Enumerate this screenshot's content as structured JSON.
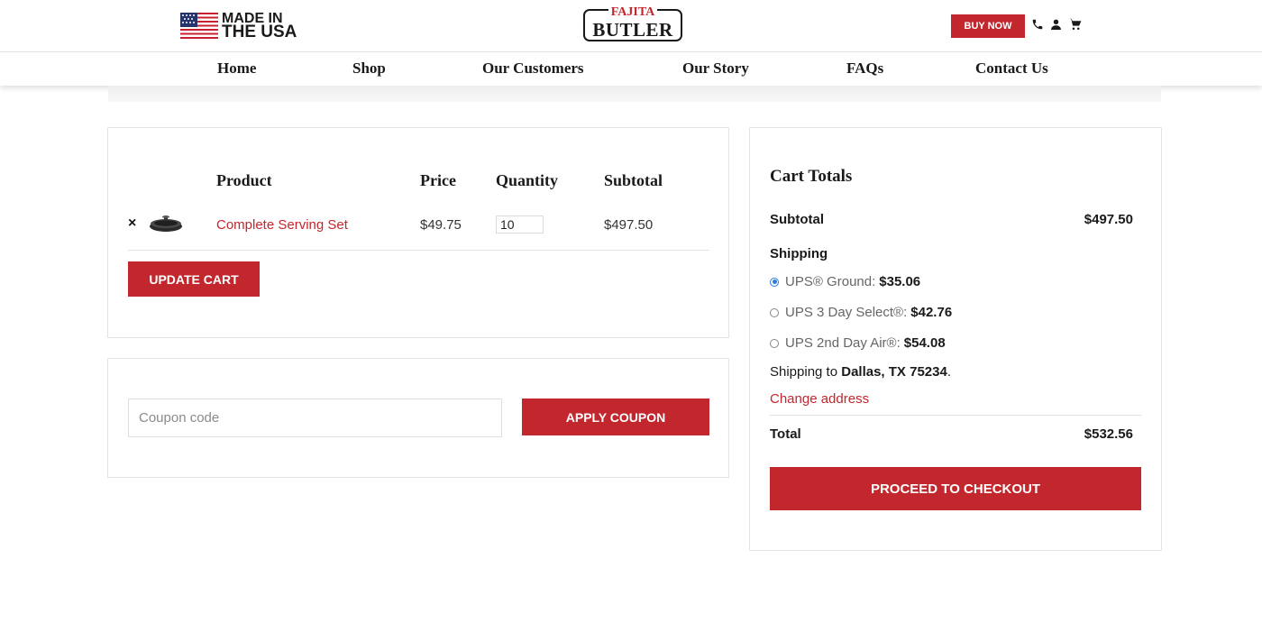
{
  "header": {
    "made_in_line1": "MADE IN",
    "made_in_line2": "THE USA",
    "logo_top": "FAJITA",
    "logo_main": "BUTLER",
    "buy_now": "BUY NOW",
    "icons": [
      "phone-icon",
      "user-icon",
      "cart-icon"
    ]
  },
  "nav": {
    "items": [
      "Home",
      "Shop",
      "Our Customers",
      "Our Story",
      "FAQs",
      "Contact Us"
    ]
  },
  "cart": {
    "headers": {
      "product": "Product",
      "price": "Price",
      "quantity": "Quantity",
      "subtotal": "Subtotal"
    },
    "items": [
      {
        "remove": "×",
        "name": "Complete Serving Set",
        "price": "$49.75",
        "quantity": "10",
        "subtotal": "$497.50"
      }
    ],
    "update_button": "Update Cart"
  },
  "coupon": {
    "placeholder": "Coupon code",
    "apply_button": "Apply Coupon"
  },
  "totals": {
    "title": "Cart Totals",
    "subtotal_label": "Subtotal",
    "subtotal_value": "$497.50",
    "shipping_label": "Shipping",
    "options": [
      {
        "label": "UPS® Ground:",
        "price": "$35.06",
        "selected": true
      },
      {
        "label": "UPS 3 Day Select®:",
        "price": "$42.76",
        "selected": false
      },
      {
        "label": "UPS 2nd Day Air®:",
        "price": "$54.08",
        "selected": false
      }
    ],
    "shipping_to_prefix": "Shipping to",
    "shipping_to_location": "Dallas, TX 75234",
    "shipping_to_suffix": ".",
    "change_address": "Change address",
    "total_label": "Total",
    "total_value": "$532.56",
    "checkout_button": "Proceed to Checkout"
  },
  "colors": {
    "brand_red": "#c1272d",
    "radio_blue": "#2a7ae2"
  }
}
